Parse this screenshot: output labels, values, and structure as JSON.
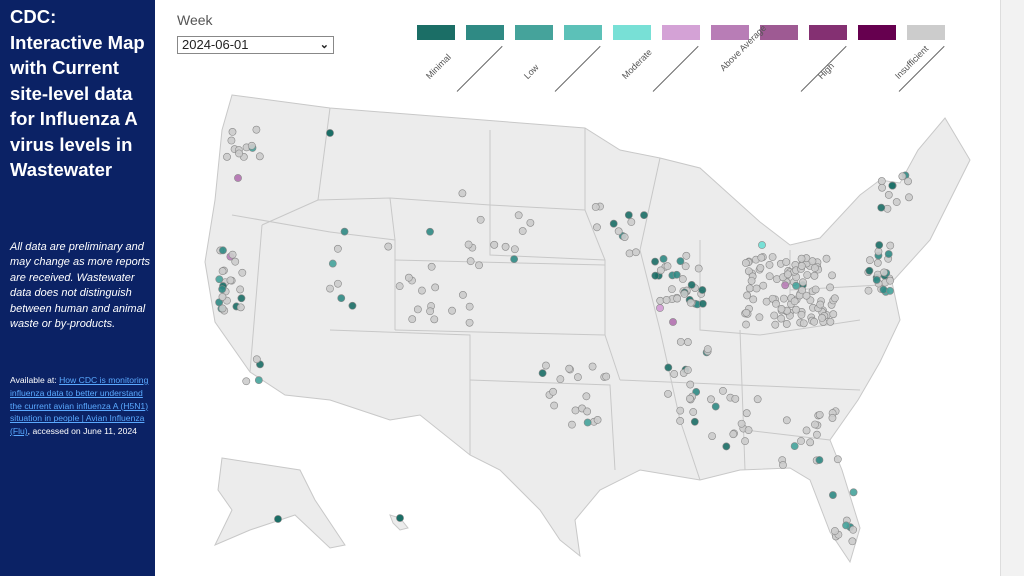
{
  "sidebar": {
    "title": "CDC: Interactive Map with Current site-level data for Influenza A virus levels in Wastewater",
    "note": "All data are preliminary and may change as more reports are received. Wastewater data does not distinguish between human and animal waste or by-products.",
    "source_prefix": "Available at: ",
    "source_link": "How CDC is monitoring influenza data to better understand the current avian influenza A (H5N1) situation in people | Avian Influenza (Flu)",
    "source_suffix": ", accessed on June 11, 2024"
  },
  "filter": {
    "week_label": "Week",
    "week_value": "2024-06-01",
    "chevron_icon": "chevron-down-icon"
  },
  "legend": {
    "swatches": [
      {
        "color": "#1b6e66"
      },
      {
        "color": "#2f8a84"
      },
      {
        "color": "#45a39b"
      },
      {
        "color": "#5cc1b8"
      },
      {
        "color": "#78e0d6"
      },
      {
        "color": "#d4a2d6"
      },
      {
        "color": "#b87db6"
      },
      {
        "color": "#9e5a93"
      },
      {
        "color": "#843072"
      },
      {
        "color": "#66004f"
      },
      {
        "color": "#cccccc"
      }
    ],
    "labels": [
      "Minimal",
      "Low",
      "Moderate",
      "Above Average",
      "High",
      "Insufficient"
    ]
  },
  "map": {
    "state_fill": "#ececec",
    "state_stroke": "#c8c8c8",
    "site_levels_shown": [
      "Minimal",
      "Low",
      "Moderate",
      "Above Average",
      "Insufficient"
    ]
  }
}
